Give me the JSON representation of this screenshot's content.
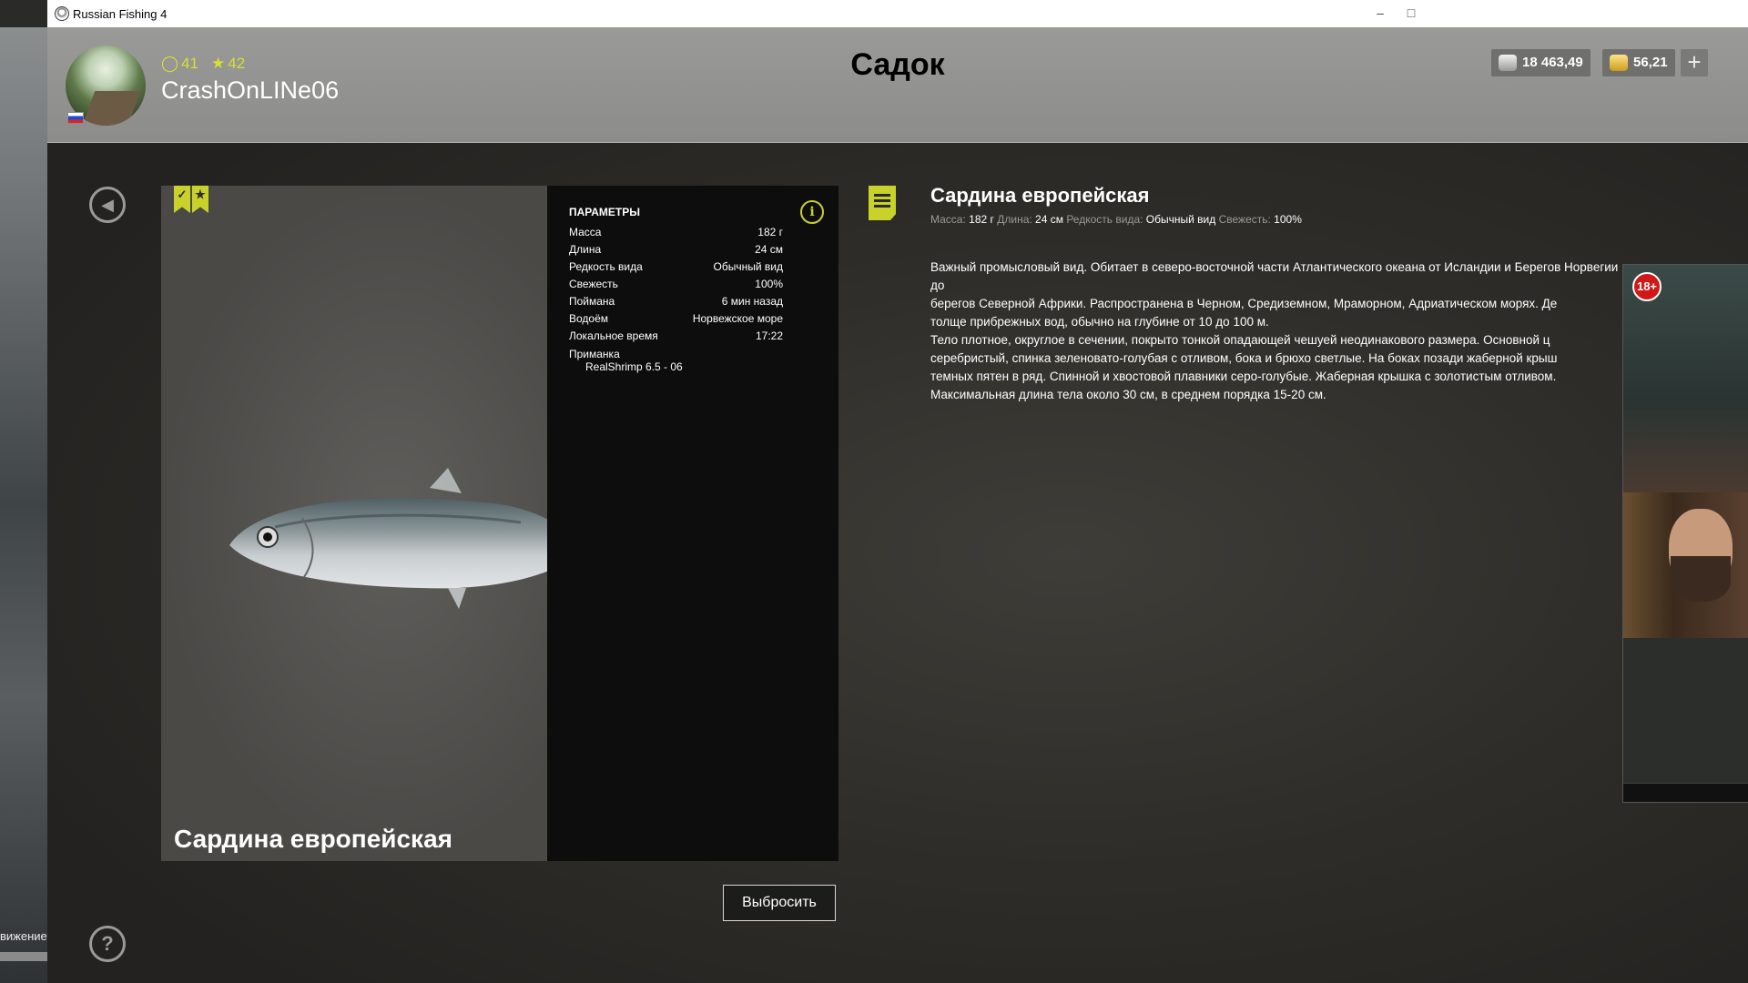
{
  "window": {
    "title": "Russian Fishing 4"
  },
  "background": {
    "left_text": "вижение"
  },
  "header": {
    "page_title": "Садок",
    "player": {
      "name": "CrashOnLINe06",
      "level": "41",
      "rank": "42"
    },
    "currency": {
      "silver": "18 463,49",
      "gold": "56,21"
    },
    "add_label": "+"
  },
  "fish": {
    "name": "Сардина европейская",
    "params_title": "ПАРАМЕТРЫ",
    "params": [
      {
        "label": "Масса",
        "value": "182 г"
      },
      {
        "label": "Длина",
        "value": "24 см"
      },
      {
        "label": "Редкость вида",
        "value": "Обычный вид"
      },
      {
        "label": "Свежесть",
        "value": "100%"
      },
      {
        "label": "Поймана",
        "value": "6 мин назад"
      },
      {
        "label": "Водоём",
        "value": "Норвежское море"
      },
      {
        "label": "Локальное время",
        "value": "17:22"
      }
    ],
    "bait_label": "Приманка",
    "bait_value": "RealShrimp 6.5 - 06"
  },
  "actions": {
    "discard": "Выбросить"
  },
  "description": {
    "title": "Сардина европейская",
    "meta": {
      "mass_label": "Масса:",
      "mass": "182 г",
      "length_label": "Длина:",
      "length": "24 см",
      "rarity_label": "Редкость вида:",
      "rarity": "Обычный вид",
      "fresh_label": "Свежесть:",
      "fresh": "100%"
    },
    "text": "Важный промысловый вид. Обитает в северо-восточной части Атлантического океана от Исландии и Берегов Норвегии до\nберегов Северной Африки. Распространена в Черном, Средиземном, Мраморном, Адриатическом морях. Де\nтолще прибрежных вод, обычно на глубине от 10 до 100 м.\nТело плотное, округлое в сечении, покрыто тонкой опадающей чешуей неодинакового размера. Основной ц\nсеребристый, спинка зеленовато-голубая с отливом, бока и брюхо светлые. На боках позади жаберной крыш\nтемных пятен в ряд. Спинной и хвостовой плавники серо-голубые. Жаберная крышка с золотистым отливом.\nМаксимальная длина тела около 30 см, в среднем порядка 15-20 см."
  },
  "overlay": {
    "age_badge": "18+"
  },
  "colors": {
    "accent": "#c9d22a",
    "header_bg": "#9a9a98",
    "panel_bg": "#0d0d0d"
  }
}
